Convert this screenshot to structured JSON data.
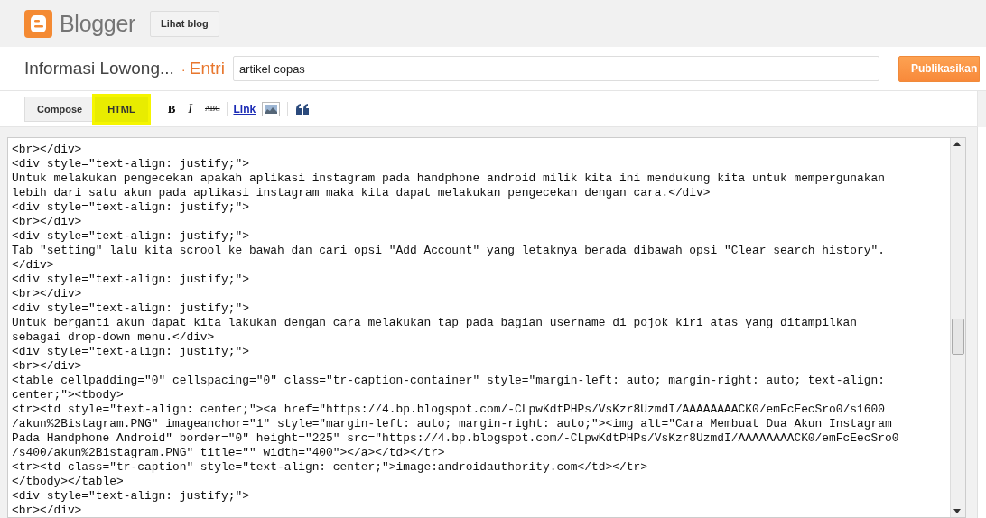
{
  "header": {
    "logo_text": "Blogger",
    "view_blog_button": "Lihat blog"
  },
  "post_bar": {
    "blog_title": "Informasi Lowong...",
    "separator": "·",
    "section": "Entri",
    "title_field": {
      "value": "artikel copas"
    },
    "publish_button": "Publikasikan"
  },
  "toolbar": {
    "modes": [
      {
        "label": "Compose",
        "selected": false
      },
      {
        "label": "HTML",
        "selected": true
      }
    ],
    "tools": [
      {
        "kind": "bold",
        "label": "B"
      },
      {
        "kind": "italic",
        "label": "I"
      },
      {
        "kind": "strike",
        "label": "ABC"
      },
      {
        "kind": "separator"
      },
      {
        "kind": "link",
        "label": "Link"
      },
      {
        "kind": "image"
      },
      {
        "kind": "separator"
      },
      {
        "kind": "quote"
      }
    ]
  },
  "editor": {
    "lines": [
      "<br></div>",
      "<div style=\"text-align: justify;\">",
      "Untuk melakukan pengecekan apakah aplikasi instagram pada handphone android milik kita ini mendukung kita untuk mempergunakan",
      "lebih dari satu akun pada aplikasi instagram maka kita dapat melakukan pengecekan dengan cara.</div>",
      "<div style=\"text-align: justify;\">",
      "<br></div>",
      "<div style=\"text-align: justify;\">",
      "Tab \"setting\" lalu kita scrool ke bawah dan cari opsi \"Add Account\" yang letaknya berada dibawah opsi \"Clear search history\".",
      "</div>",
      "<div style=\"text-align: justify;\">",
      "<br></div>",
      "<div style=\"text-align: justify;\">",
      "Untuk berganti akun dapat kita lakukan dengan cara melakukan tap pada bagian username di pojok kiri atas yang ditampilkan",
      "sebagai drop-down menu.</div>",
      "<div style=\"text-align: justify;\">",
      "<br></div>",
      "<table cellpadding=\"0\" cellspacing=\"0\" class=\"tr-caption-container\" style=\"margin-left: auto; margin-right: auto; text-align:",
      "center;\"><tbody>",
      "<tr><td style=\"text-align: center;\"><a href=\"https://4.bp.blogspot.com/-CLpwKdtPHPs/VsKzr8UzmdI/AAAAAAAACK0/emFcEecSro0/s1600",
      "/akun%2Bistagram.PNG\" imageanchor=\"1\" style=\"margin-left: auto; margin-right: auto;\"><img alt=\"Cara Membuat Dua Akun Instagram",
      "Pada Handphone Android\" border=\"0\" height=\"225\" src=\"https://4.bp.blogspot.com/-CLpwKdtPHPs/VsKzr8UzmdI/AAAAAAAACK0/emFcEecSro0",
      "/s400/akun%2Bistagram.PNG\" title=\"\" width=\"400\"></a></td></tr>",
      "<tr><td class=\"tr-caption\" style=\"text-align: center;\">image:androidauthority.com</td></tr>",
      "</tbody></table>",
      "<div style=\"text-align: justify;\">",
      "<br></div>"
    ]
  }
}
